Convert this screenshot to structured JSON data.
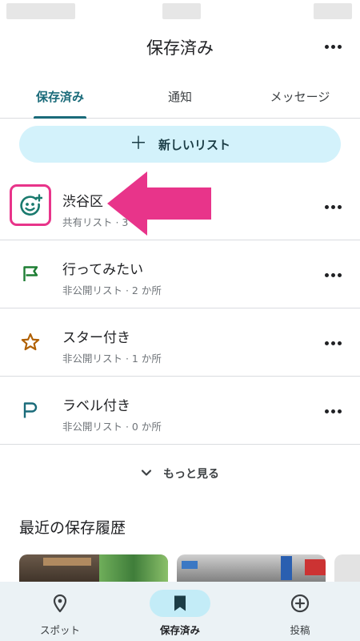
{
  "header": {
    "title": "保存済み",
    "more_icon": "more-horizontal-icon"
  },
  "tabs": [
    {
      "label": "保存済み",
      "active": true
    },
    {
      "label": "通知",
      "active": false
    },
    {
      "label": "メッセージ",
      "active": false
    }
  ],
  "new_list": {
    "icon": "plus-icon",
    "plus": "＋",
    "label": "新しいリスト"
  },
  "lists": [
    {
      "title": "渋谷区",
      "subtitle": "共有リスト · 3",
      "icon": "face-add-icon",
      "color": "#1a7a6e",
      "highlighted": true
    },
    {
      "title": "行ってみたい",
      "subtitle": "非公開リスト · 2 か所",
      "icon": "flag-icon",
      "color": "#1e7e34"
    },
    {
      "title": "スター付き",
      "subtitle": "非公開リスト · 1 か所",
      "icon": "star-icon",
      "color": "#b06000"
    },
    {
      "title": "ラベル付き",
      "subtitle": "非公開リスト · 0 か所",
      "icon": "label-flag-icon",
      "color": "#1a6b7a"
    }
  ],
  "annotation": {
    "highlight_color": "#e8348a",
    "arrow_icon": "pointing-arrow-icon"
  },
  "more_link": {
    "chevron": "⌄",
    "label": "もっと見る"
  },
  "recent": {
    "title": "最近の保存履歴"
  },
  "bottom_nav": [
    {
      "label": "スポット",
      "icon": "location-pin-icon",
      "active": false
    },
    {
      "label": "保存済み",
      "icon": "bookmark-icon",
      "active": true
    },
    {
      "label": "投稿",
      "icon": "add-circle-icon",
      "active": false
    }
  ],
  "colors": {
    "accent": "#1a6b7a",
    "button_bg": "#d3f2fb",
    "nav_bg": "#ebf2f5",
    "nav_active_pill": "#c3ecf7"
  }
}
